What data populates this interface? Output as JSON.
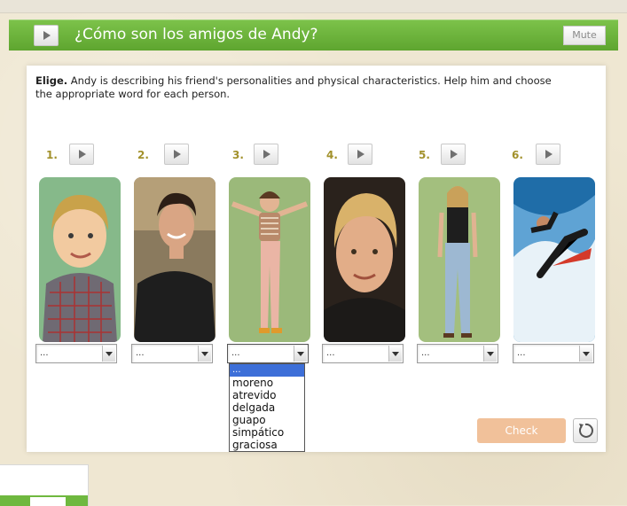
{
  "header": {
    "title": "¿Cómo son los amigos de Andy?",
    "mute_label": "Mute"
  },
  "instructions": {
    "lead": "Elige.",
    "text": " Andy is describing his friend's personalities and physical characteristics. Help him and choose the appropriate word for each person."
  },
  "items": [
    {
      "number": "1.",
      "selected": "..."
    },
    {
      "number": "2.",
      "selected": "..."
    },
    {
      "number": "3.",
      "selected": "..."
    },
    {
      "number": "4.",
      "selected": "..."
    },
    {
      "number": "5.",
      "selected": "..."
    },
    {
      "number": "6.",
      "selected": "..."
    }
  ],
  "dropdown": {
    "placeholder": "...",
    "options": [
      "moreno",
      "atrevido",
      "delgada",
      "guapo",
      "simpático",
      "graciosa"
    ]
  },
  "check_label": "Check",
  "icons": {
    "play": "play-icon",
    "reset": "reset-icon",
    "dropdown_arrow": "chevron-down-icon"
  },
  "colors": {
    "header_green": "#6ab33a",
    "number_gold": "#a2912b",
    "check_disabled": "#f1c19a",
    "dropdown_highlight": "#3d6fd8"
  }
}
